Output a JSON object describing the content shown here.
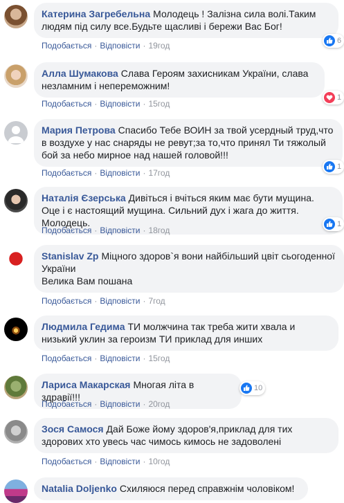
{
  "labels": {
    "like": "Подобається",
    "reply": "Відповісти",
    "separator": "·"
  },
  "colors": {
    "link": "#385898",
    "meta": "#90949c",
    "bubble": "#f2f3f5",
    "like": "#1877f2",
    "love": "#f33e58"
  },
  "comments": [
    {
      "author": "Катерина Загребельна",
      "text": "Молодець ! Залізна сила волі.Таким людям під силу все.Будьте щасливі і бережи Вас Бог!",
      "time": "19год",
      "reaction_icon": "like-icon",
      "reaction_count": "6"
    },
    {
      "author": "Алла Шумакова",
      "text": "Слава Героям захисникам України, слава незламним і непереможним!",
      "time": "15год",
      "reaction_icon": "love-icon",
      "reaction_count": "1"
    },
    {
      "author": "Мария Петрова",
      "text": "Спасибо Тебе ВОИН за твой усердный труд,что в воздухе у нас снаряды не ревут;за то,что принял Ти тяжолый бой за небо мирное над нашей головой!!!",
      "time": "17год",
      "reaction_icon": "like-icon",
      "reaction_count": "1"
    },
    {
      "author": "Наталія Єзерська",
      "text": "Дивіться і вчіться яким має бути мущина. Оце і є настоящий мущина. Сильний дух і жага до життя. Молодець.",
      "time": "18год",
      "reaction_icon": "like-icon",
      "reaction_count": "1"
    },
    {
      "author": "Stanislav Zp",
      "text": "Міцного здоров`я вони найбільший цвіт сьогоденної України",
      "text2": "Велика Вам пошана",
      "time": "7год"
    },
    {
      "author": "Людмила Гедима",
      "text": "ТИ молжчина так треба жити хвала и низький уклин за героизм ТИ приклад для инших",
      "time": "15год"
    },
    {
      "author": "Лариса Макарская",
      "text": "Многая літа в здравії!!!",
      "time": "20год",
      "reaction_icon": "like-icon",
      "reaction_count": "10"
    },
    {
      "author": "Зося Самося",
      "text": "Дай Боже йому здоров'я,приклад для тих здорових хто увесь час чимось кимось не задоволені",
      "time": "10год"
    },
    {
      "author": "Natalia Doljenko",
      "text": "Схиляюся перед справжнім чоловіком!"
    }
  ]
}
